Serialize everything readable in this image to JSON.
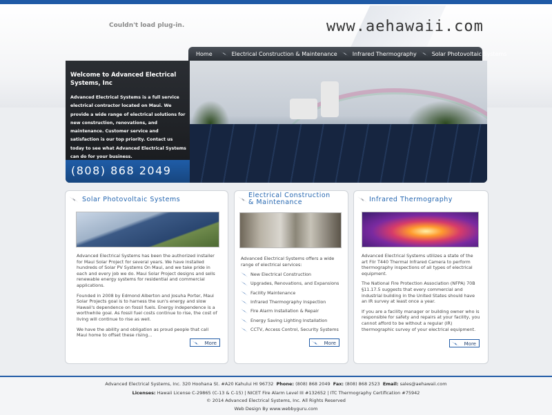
{
  "header": {
    "plugin_message": "Couldn't load plug-in.",
    "site_url": "www.aehawaii.com"
  },
  "nav": {
    "items": [
      {
        "label": "Home"
      },
      {
        "label": "Electrical Construction & Maintenance"
      },
      {
        "label": "Infrared Thermography"
      },
      {
        "label": "Solar Photovoltaic Systems"
      }
    ]
  },
  "hero": {
    "title": "Welcome to Advanced Electrical Systems, Inc",
    "intro": "Advanced Electrical Systems is a full service electrical contractor located on Maui. We provide a wide range of electrical solutions for new construction, renovations, and maintenance. Customer service and satisfaction is our top priority. Contact us today to see what Advanced Electrical Systems can do for your business.",
    "phone": "(808) 868 2049"
  },
  "cards": {
    "solar": {
      "title": "Solar Photovoltaic Systems",
      "paragraphs": [
        "Advanced Electrical Systems has been the authorized installer for Maui Solar Project for several years. We have installed hundreds of Solar PV Systems On Maui, and we take pride in each and every job we do. Maui Solar Project designs and sells renewable energy systems for residential and commercial applications.",
        "Founded in 2008 by Edmond Alberton and Josuha Porter, Maui Solar Projects goal is to harness the sun's energy and slow Hawaii's dependence on fossil fuels. Energy independence is a worthwhile goal. As fossil fuel costs continue to rise, the cost of living will continue to rise as well.",
        "We have the ability and obligation as proud people that call Maui home to offset these rising..."
      ],
      "more_label": "More"
    },
    "electrical": {
      "title_line1": "Electrical Construction",
      "title_line2": "& Maintenance",
      "intro": "Advanced Electrical Systems offers a wide range of electrical services:",
      "services": [
        "New Electrical Construction",
        "Upgrades, Renovations, and Expansions",
        "Facility Maintenance",
        "Infrared Thermography Inspection",
        "Fire Alarm Installation & Repair",
        "Energy Saving Lighting Installation",
        "CCTV, Access Control, Security Systems"
      ],
      "more_label": "More"
    },
    "thermo": {
      "title": "Infrared Thermography",
      "paragraphs": [
        "Advanced Electrical Systems utilizes a state of the art Flir T440 Thermal Infrared Camera to perform thermography inspections of all types of electrical equipment.",
        "The National Fire Protection Association (NFPA) 70B §11.17.5 suggests that every commercial and industrial building in the United States should have an IR survey at least once a year.",
        "If you are a facility manager or building owner who is responsible for safety and repairs at your facility, you cannot afford to be without a regular (IR) thermographic survey of your electrical equipment."
      ],
      "more_label": "More"
    }
  },
  "footer": {
    "address": "Advanced Electrical Systems, Inc. 320 Hoohana St. #A20 Kahului HI 96732",
    "phone_label": "Phone:",
    "phone": "(808) 868 2049",
    "fax_label": "Fax:",
    "fax": "(808) 868 2523",
    "email_label": "Email:",
    "email": "sales@aehawaii.com",
    "licenses_label": "Licenses:",
    "licenses": "Hawaii License C-29865 (C-13 & C-15) | NICET Fire Alarm Level III #132652 | ITC Thermography Certification #75942",
    "copyright": "© 2014 Advanced Electrical Systems, Inc. All Rights Reserved",
    "credit": "Web Design By www.webbyguru.com"
  },
  "colors": {
    "brand_blue": "#1f5aa6",
    "title_blue": "#2466b0",
    "nav_dark": "#2a2f35"
  }
}
